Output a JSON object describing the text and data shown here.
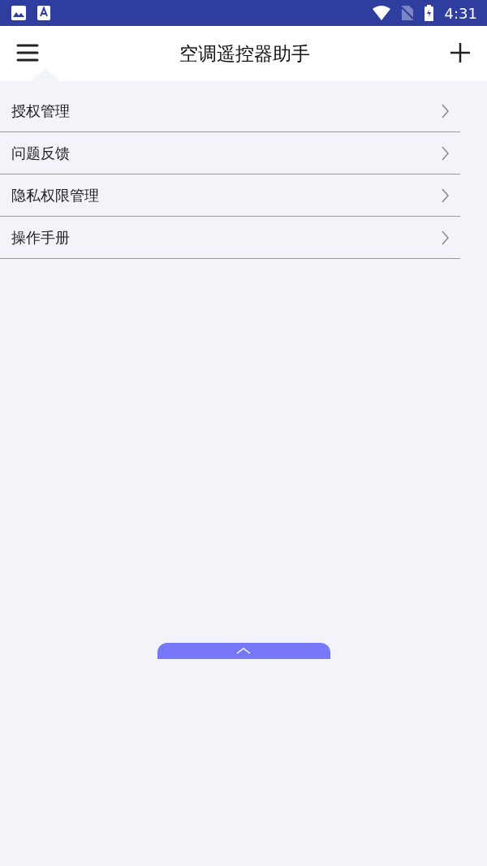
{
  "status_bar": {
    "time": "4:31"
  },
  "header": {
    "title": "空调遥控器助手"
  },
  "menu": {
    "items": [
      {
        "label": "授权管理"
      },
      {
        "label": "问题反馈"
      },
      {
        "label": "隐私权限管理"
      },
      {
        "label": "操作手册"
      }
    ]
  }
}
